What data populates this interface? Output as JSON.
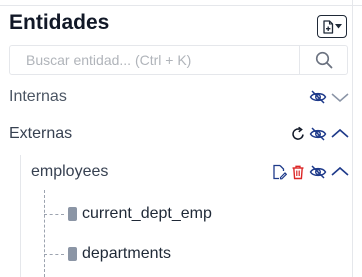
{
  "panel": {
    "title": "Entidades",
    "search": {
      "placeholder": "Buscar entidad... (Ctrl + K)",
      "value": ""
    }
  },
  "tree": {
    "internas": {
      "label": "Internas"
    },
    "externas": {
      "label": "Externas"
    },
    "employees": {
      "label": "employees",
      "children": [
        {
          "label": "current_dept_emp"
        },
        {
          "label": "departments"
        }
      ]
    }
  },
  "colors": {
    "accent": "#1e3a8a",
    "delete": "#dc2626",
    "tree_line": "#9ca3af"
  }
}
